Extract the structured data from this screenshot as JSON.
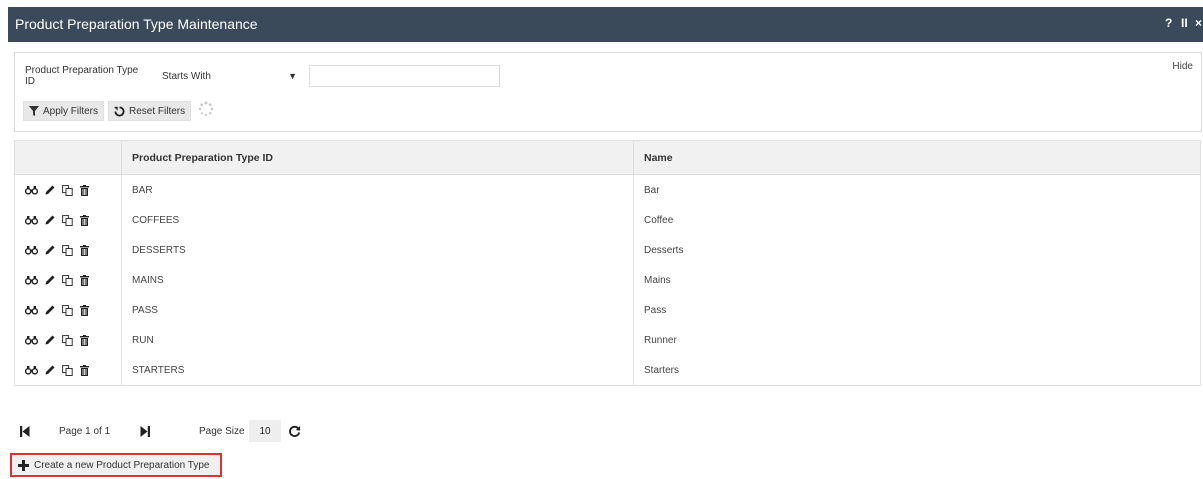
{
  "window": {
    "title": "Product Preparation Type Maintenance",
    "help_label": "?",
    "pause_label": "II",
    "close_label": "×"
  },
  "filter": {
    "field_label": "Product Preparation Type ID",
    "operator_value": "Starts With",
    "value": "",
    "hide_label": "Hide",
    "apply_label": "Apply Filters",
    "reset_label": "Reset Filters"
  },
  "table": {
    "columns": [
      "",
      "Product Preparation Type ID",
      "Name"
    ],
    "rows": [
      {
        "id": "BAR",
        "name": "Bar"
      },
      {
        "id": "COFFEES",
        "name": "Coffee"
      },
      {
        "id": "DESSERTS",
        "name": "Desserts"
      },
      {
        "id": "MAINS",
        "name": "Mains"
      },
      {
        "id": "PASS",
        "name": "Pass"
      },
      {
        "id": "RUN",
        "name": "Runner"
      },
      {
        "id": "STARTERS",
        "name": "Starters"
      }
    ]
  },
  "pager": {
    "page_text": "Page 1 of 1",
    "page_size_label": "Page Size",
    "page_size_value": "10"
  },
  "create_label": "Create a new Product Preparation Type",
  "icons": {
    "row_actions": [
      "binoculars-icon",
      "pencil-icon",
      "copy-icon",
      "trash-icon"
    ],
    "pager": [
      "first-page-icon",
      "last-page-icon",
      "refresh-icon"
    ]
  },
  "colors": {
    "titlebar_bg": "#3b4a5a",
    "header_bg": "#f1f1f1",
    "highlight_border": "#e03030"
  }
}
